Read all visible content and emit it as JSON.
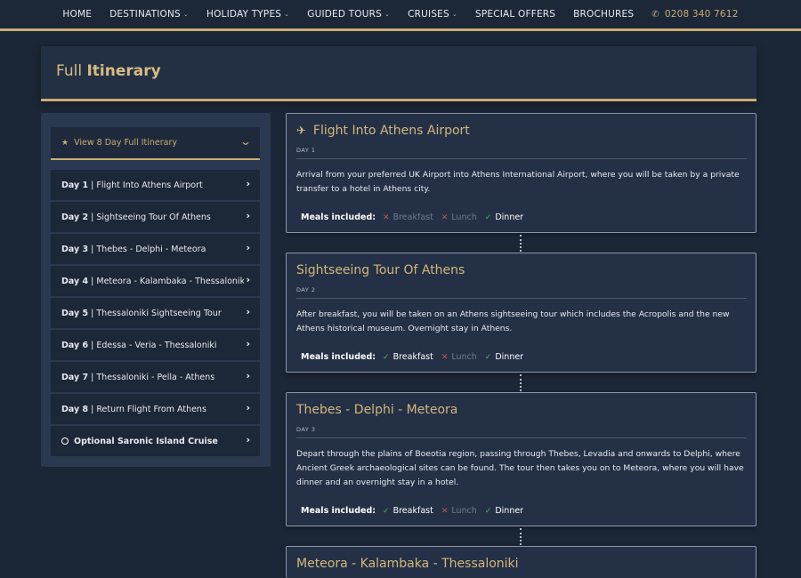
{
  "nav": {
    "items": [
      {
        "label": "HOME",
        "dropdown": false
      },
      {
        "label": "DESTINATIONS",
        "dropdown": true
      },
      {
        "label": "HOLIDAY TYPES",
        "dropdown": true
      },
      {
        "label": "GUIDED TOURS",
        "dropdown": true
      },
      {
        "label": "CRUISES",
        "dropdown": true
      },
      {
        "label": "SPECIAL OFFERS",
        "dropdown": false
      },
      {
        "label": "BROCHURES",
        "dropdown": false
      }
    ],
    "phone": "0208 340 7612",
    "caret": "⌄"
  },
  "header": {
    "title_light": "Full ",
    "title_bold": "Itinerary"
  },
  "sidebar": {
    "toggle_label": "View 8 Day Full Itinerary",
    "items": [
      {
        "day": "Day 1",
        "sep": " | ",
        "title": "Flight Into Athens Airport"
      },
      {
        "day": "Day 2",
        "sep": " | ",
        "title": "Sightseeing Tour Of Athens"
      },
      {
        "day": "Day 3",
        "sep": " | ",
        "title": "Thebes - Delphi - Meteora"
      },
      {
        "day": "Day 4",
        "sep": " | ",
        "title": "Meteora - Kalambaka - Thessaloniki"
      },
      {
        "day": "Day 5",
        "sep": " | ",
        "title": "Thessaloniki Sightseeing Tour"
      },
      {
        "day": "Day 6",
        "sep": " | ",
        "title": "Edessa - Veria - Thessaloniki"
      },
      {
        "day": "Day 7",
        "sep": " | ",
        "title": "Thessaloniki - Pella - Athens"
      },
      {
        "day": "Day 8",
        "sep": " | ",
        "title": "Return Flight From Athens"
      }
    ],
    "optional": "Optional Saronic Island Cruise",
    "arrow": "›"
  },
  "cards": [
    {
      "title": "Flight Into Athens Airport",
      "day": "DAY 1",
      "description": "Arrival from your preferred UK Airport into Athens International Airport, where you will be taken by a private transfer to a hotel in Athens city.",
      "meals_label": "Meals included:",
      "meals": [
        {
          "name": "Breakfast",
          "included": false,
          "mark": "✕"
        },
        {
          "name": "Lunch",
          "included": false,
          "mark": "✕"
        },
        {
          "name": "Dinner",
          "included": true,
          "mark": "✓"
        }
      ]
    },
    {
      "title": "Sightseeing Tour Of Athens",
      "day": "DAY 2",
      "description": "After breakfast, you will be taken on an Athens sightseeing tour which includes the Acropolis and the new Athens historical museum. Overnight stay in Athens.",
      "meals_label": "Meals included:",
      "meals": [
        {
          "name": "Breakfast",
          "included": true,
          "mark": "✓"
        },
        {
          "name": "Lunch",
          "included": false,
          "mark": "✕"
        },
        {
          "name": "Dinner",
          "included": true,
          "mark": "✓"
        }
      ]
    },
    {
      "title": "Thebes - Delphi - Meteora",
      "day": "DAY 3",
      "description": "Depart through the plains of Boeotia region, passing through Thebes, Levadia and onwards to Delphi, where Ancient Greek archaeological sites can be found. The tour then takes you on to Meteora, where you will have dinner and an overnight stay in a hotel.",
      "meals_label": "Meals included:",
      "meals": [
        {
          "name": "Breakfast",
          "included": true,
          "mark": "✓"
        },
        {
          "name": "Lunch",
          "included": false,
          "mark": "✕"
        },
        {
          "name": "Dinner",
          "included": true,
          "mark": "✓"
        }
      ]
    },
    {
      "title": "Meteora - Kalambaka - Thessaloniki"
    }
  ],
  "colors": {
    "gold": "#c9ad72",
    "background": "#1b2636",
    "card": "#243045",
    "included": "#3fbf4f",
    "excluded": "#c0574f"
  }
}
